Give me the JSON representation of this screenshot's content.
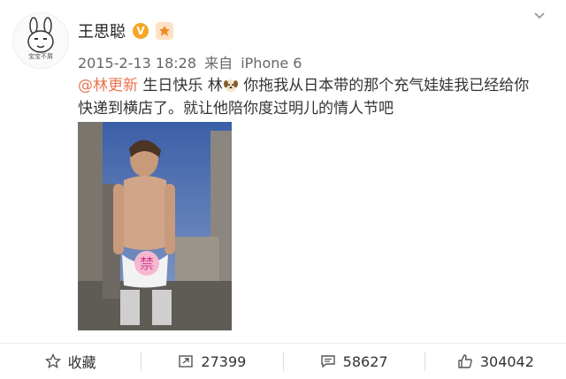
{
  "header": {
    "avatar_caption": "宝宝不屑",
    "author": "王思聪",
    "verified_badge": "V"
  },
  "meta": {
    "timestamp": "2015-2-13 18:28",
    "source_prefix": "来自",
    "source": "iPhone 6"
  },
  "post": {
    "mention": "@林更新",
    "text_part1": " 生日快乐 林",
    "text_part2": " 你拖我从日本带的那个充气娃娃我已经给你快递到横店了。就让他陪你度过明儿的情人节吧",
    "image_label": "禁"
  },
  "toolbar": {
    "favorite_label": "收藏",
    "repost_count": "27399",
    "comment_count": "58627",
    "like_count": "304042"
  },
  "colors": {
    "mention": "#eb7350",
    "badge": "#f5a623"
  },
  "icons": [
    "avatar-icon",
    "verified-icon",
    "level-badge-icon",
    "chevron-down-icon",
    "dog-emoji-icon",
    "star-icon",
    "repost-icon",
    "comment-icon",
    "like-icon"
  ]
}
